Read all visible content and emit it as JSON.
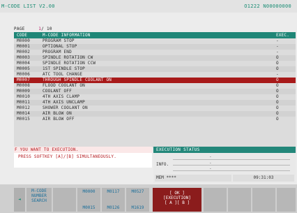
{
  "title": "M-CODE LIST V2.00",
  "program": "O1222 N00000000",
  "page": {
    "label": "PAGE",
    "current": "1",
    "separator": "/",
    "total": "10"
  },
  "columns": {
    "code": "CODE",
    "info": "M-CODE INFORMATION",
    "exec": "EXEC."
  },
  "rows": [
    {
      "code": "M0000",
      "info": "PROGRAM STOP",
      "exec": "-"
    },
    {
      "code": "M0001",
      "info": "OPTIONAL STOP",
      "exec": "-"
    },
    {
      "code": "M0002",
      "info": "PROGRAM END",
      "exec": "-"
    },
    {
      "code": "M0003",
      "info": "SPINDLE ROTATION CW",
      "exec": "O"
    },
    {
      "code": "M0004",
      "info": "SPINDLE ROTATION CCW",
      "exec": "O"
    },
    {
      "code": "M0005",
      "info": "1ST SPINDLE STOP",
      "exec": "O"
    },
    {
      "code": "M0006",
      "info": "ATC TOOL CHANGE",
      "exec": "-"
    },
    {
      "code": "M0007",
      "info": "THROUGH SPINDLE COOLANT ON",
      "exec": "O"
    },
    {
      "code": "M0008",
      "info": "FLOOD COOLANT ON",
      "exec": "O"
    },
    {
      "code": "M0009",
      "info": "COOLANT OFF",
      "exec": "O"
    },
    {
      "code": "M0010",
      "info": "4TH AXIS CLAMP",
      "exec": "O"
    },
    {
      "code": "M0011",
      "info": "4TH AXIS UNCLAMP",
      "exec": "O"
    },
    {
      "code": "M0012",
      "info": "SHOWER COOLANT ON",
      "exec": "O"
    },
    {
      "code": "M0014",
      "info": "AIR BLOW ON",
      "exec": "O"
    },
    {
      "code": "M0015",
      "info": "AIR BLOW OFF",
      "exec": "O"
    }
  ],
  "message": {
    "line1": "F YOU WANT TO EXECUTION.",
    "line2": "PRESS SOFTKEY [A]/[B] SIMULTANEOUSLY."
  },
  "execution_status": {
    "title": "EXECUTION STATUS",
    "info_label": "INFO.",
    "dash": "-",
    "mem": "MEM  ****",
    "time": "09:31:03"
  },
  "softkeys": {
    "nav": "◄",
    "search": "M-CODE\nNUMBER\nSEARCH",
    "k1_top": "M0000",
    "k1_bot": "M0015",
    "k2_top": "M0117",
    "k2_bot": "M0126",
    "k3_top": "M0527",
    "k3_bot": "M1619",
    "execute": "[  OK  ]\n[EXECUTION]\n[ A ][ B ]"
  },
  "colors": {
    "header": "#1f8677",
    "selected_row": "#a81a1a",
    "message": "#b5171c",
    "program_text": "#1a8d74"
  }
}
